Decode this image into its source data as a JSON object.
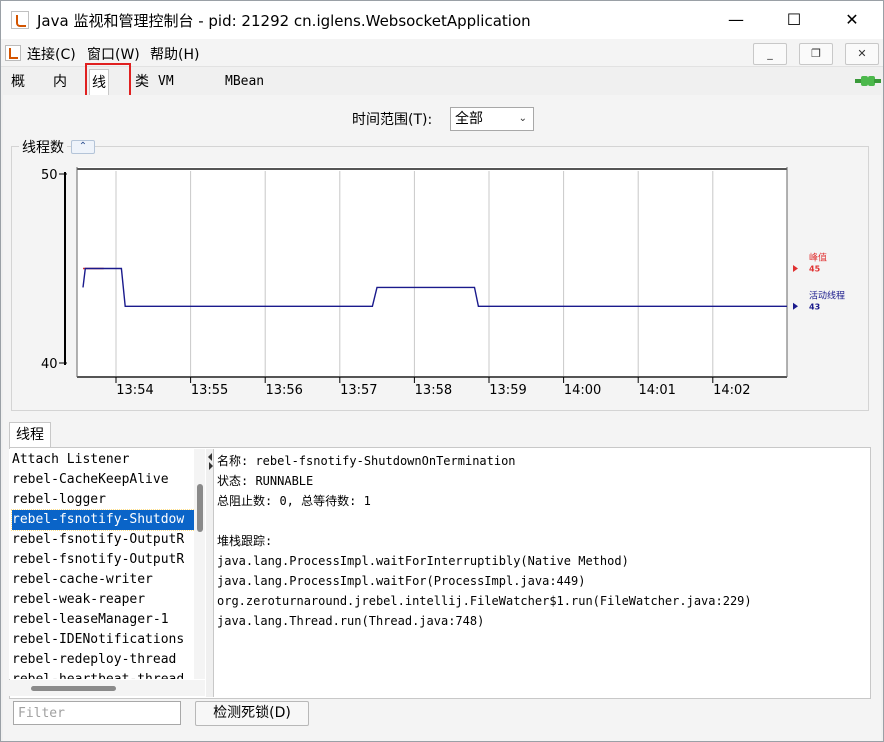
{
  "window": {
    "title": "Java 监视和管理控制台 - pid: 21292 cn.iglens.WebsocketApplication",
    "minimize": "—",
    "maximize": "☐",
    "close": "✕"
  },
  "menu": {
    "items": [
      "连接(C)",
      "窗口(W)",
      "帮助(H)"
    ],
    "mdi_minimize": "_",
    "mdi_restore": "❐",
    "mdi_close": "✕"
  },
  "tabs": [
    "概览",
    "内存",
    "线程",
    "类",
    "VM 概要",
    "MBean"
  ],
  "active_tab": "线程",
  "time_range": {
    "label": "时间范围(T):",
    "value": "全部"
  },
  "chart_section": {
    "title": "线程数",
    "collapse_icon": "chevron-up-icon"
  },
  "chart_data": {
    "type": "line",
    "y_ticks": [
      "50",
      "40"
    ],
    "ylim": [
      40,
      50
    ],
    "x_ticks": [
      "13:54",
      "13:55",
      "13:56",
      "13:57",
      "13:58",
      "13:59",
      "14:00",
      "14:01",
      "14:02"
    ],
    "x_range": [
      "13:53.4",
      "14:02.9"
    ],
    "series": [
      {
        "name": "峰值",
        "current": "45",
        "color": "#e03030",
        "points": [
          [
            13.75,
            45
          ],
          [
            14.02,
            45
          ]
        ]
      },
      {
        "name": "活动线程",
        "current": "43",
        "color": "#1a1a8c",
        "points": [
          [
            13.75,
            44
          ],
          [
            13.78,
            45
          ],
          [
            14.25,
            45
          ],
          [
            14.3,
            43
          ],
          [
            17.52,
            43
          ],
          [
            17.58,
            44
          ],
          [
            18.85,
            44
          ],
          [
            18.9,
            43
          ],
          [
            22.92,
            43
          ]
        ]
      }
    ]
  },
  "threads": {
    "tab_label": "线程",
    "list": [
      "Attach Listener",
      "rebel-CacheKeepAlive",
      "rebel-logger",
      "rebel-fsnotify-Shutdow",
      "rebel-fsnotify-OutputR",
      "rebel-fsnotify-OutputR",
      "rebel-cache-writer",
      "rebel-weak-reaper",
      "rebel-leaseManager-1",
      "rebel-IDENotifications",
      "rebel-redeploy-thread",
      "rebel-heartbeat-thread"
    ],
    "selected": "rebel-fsnotify-Shutdow",
    "detail": [
      "名称: rebel-fsnotify-ShutdownOnTermination",
      "状态: RUNNABLE",
      "总阻止数: 0, 总等待数: 1",
      "",
      "堆栈跟踪:",
      "java.lang.ProcessImpl.waitForInterruptibly(Native Method)",
      "java.lang.ProcessImpl.waitFor(ProcessImpl.java:449)",
      "org.zeroturnaround.jrebel.intellij.FileWatcher$1.run(FileWatcher.java:229)",
      "java.lang.Thread.run(Thread.java:748)"
    ]
  },
  "bottom": {
    "filter_placeholder": "Filter",
    "deadlock_button": "检测死锁(D)"
  }
}
